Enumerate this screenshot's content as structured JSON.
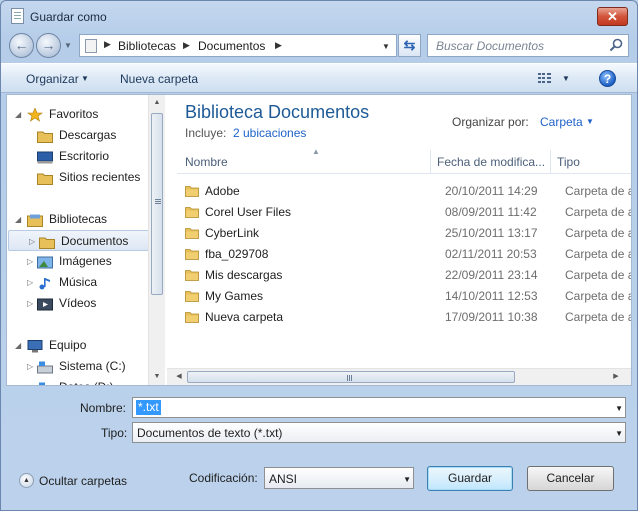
{
  "window": {
    "title": "Guardar como"
  },
  "address": {
    "crumbs": [
      "Bibliotecas",
      "Documentos"
    ]
  },
  "search": {
    "placeholder": "Buscar Documentos"
  },
  "toolbar": {
    "organize": "Organizar",
    "new_folder": "Nueva carpeta"
  },
  "sidebar": {
    "items": [
      {
        "label": "Favoritos",
        "level": 0,
        "icon": "star-icon"
      },
      {
        "label": "Descargas",
        "level": 1,
        "icon": "downloads-folder-icon"
      },
      {
        "label": "Escritorio",
        "level": 1,
        "icon": "desktop-icon"
      },
      {
        "label": "Sitios recientes",
        "level": 1,
        "icon": "recent-places-icon"
      },
      {
        "label": "Bibliotecas",
        "level": 0,
        "icon": "libraries-icon"
      },
      {
        "label": "Documentos",
        "level": 1,
        "icon": "documents-library-icon",
        "selected": true
      },
      {
        "label": "Imágenes",
        "level": 1,
        "icon": "pictures-library-icon"
      },
      {
        "label": "Música",
        "level": 1,
        "icon": "music-library-icon"
      },
      {
        "label": "Vídeos",
        "level": 1,
        "icon": "videos-library-icon"
      },
      {
        "label": "Equipo",
        "level": 0,
        "icon": "computer-icon"
      },
      {
        "label": "Sistema (C:)",
        "level": 1,
        "icon": "drive-icon"
      },
      {
        "label": "Datos (D:)",
        "level": 1,
        "icon": "drive-icon"
      }
    ]
  },
  "library": {
    "title": "Biblioteca Documentos",
    "includes_label": "Incluye:",
    "includes_link": "2 ubicaciones",
    "arrange_label": "Organizar por:",
    "arrange_value": "Carpeta"
  },
  "columns": {
    "name": "Nombre",
    "date": "Fecha de modifica...",
    "type": "Tipo"
  },
  "files": [
    {
      "name": "Adobe",
      "date": "20/10/2011 14:29",
      "type": "Carpeta de a"
    },
    {
      "name": "Corel User Files",
      "date": "08/09/2011 11:42",
      "type": "Carpeta de a"
    },
    {
      "name": "CyberLink",
      "date": "25/10/2011 13:17",
      "type": "Carpeta de a"
    },
    {
      "name": "fba_029708",
      "date": "02/11/2011 20:53",
      "type": "Carpeta de a"
    },
    {
      "name": "Mis descargas",
      "date": "22/09/2011 23:14",
      "type": "Carpeta de a"
    },
    {
      "name": "My Games",
      "date": "14/10/2011 12:53",
      "type": "Carpeta de a"
    },
    {
      "name": "Nueva carpeta",
      "date": "17/09/2011 10:38",
      "type": "Carpeta de a"
    }
  ],
  "form": {
    "name_label": "Nombre:",
    "name_value": "*.txt",
    "type_label": "Tipo:",
    "type_value": "Documentos de texto (*.txt)",
    "encoding_label": "Codificación:",
    "encoding_value": "ANSI",
    "hide_folders": "Ocultar carpetas",
    "save": "Guardar",
    "cancel": "Cancelar"
  },
  "colors": {
    "accent": "#1e5a96",
    "link": "#1f62c9",
    "selection": "#3399ff",
    "folder": "#e8c05a",
    "close": "#d2543a"
  }
}
